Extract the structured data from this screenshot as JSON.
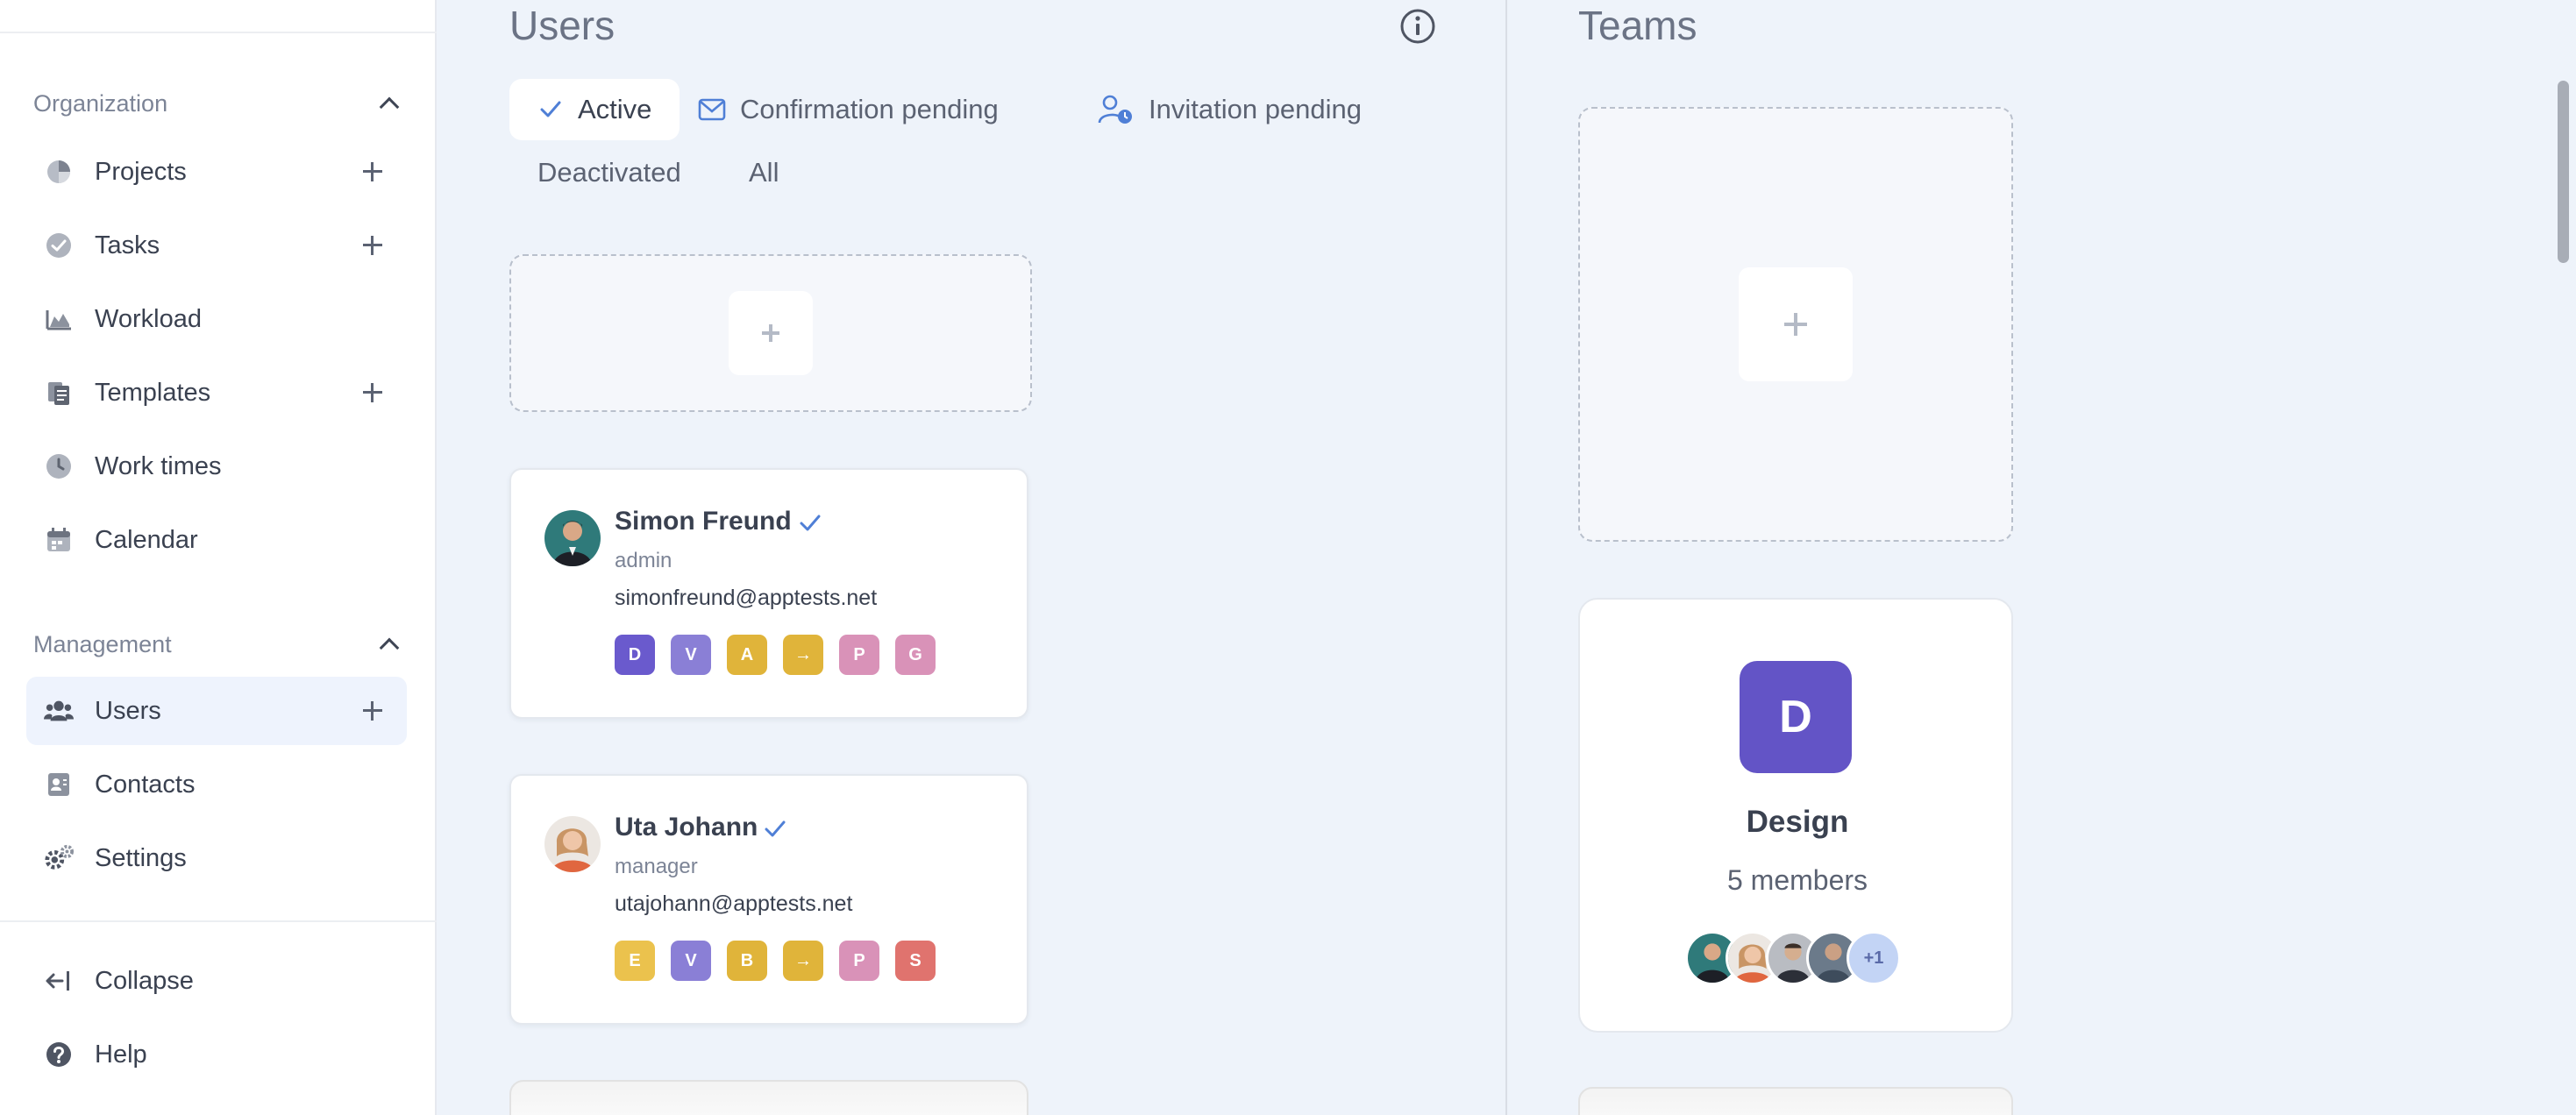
{
  "sidebar": {
    "organization_label": "Organization",
    "org_items": [
      {
        "label": "Projects",
        "icon": "pie-chart-icon",
        "has_add": true
      },
      {
        "label": "Tasks",
        "icon": "check-circle-icon",
        "has_add": true
      },
      {
        "label": "Workload",
        "icon": "area-chart-icon",
        "has_add": false
      },
      {
        "label": "Templates",
        "icon": "documents-icon",
        "has_add": true
      },
      {
        "label": "Work times",
        "icon": "clock-icon",
        "has_add": false
      },
      {
        "label": "Calendar",
        "icon": "calendar-icon",
        "has_add": false
      }
    ],
    "management_label": "Management",
    "mgmt_items": [
      {
        "label": "Users",
        "icon": "users-icon",
        "has_add": true,
        "active": true
      },
      {
        "label": "Contacts",
        "icon": "contact-card-icon",
        "has_add": false
      },
      {
        "label": "Settings",
        "icon": "gears-icon",
        "has_add": false
      }
    ],
    "bottom_items": [
      {
        "label": "Collapse",
        "icon": "collapse-arrow-icon"
      },
      {
        "label": "Help",
        "icon": "help-circle-icon"
      }
    ]
  },
  "users": {
    "title": "Users",
    "filters": [
      {
        "label": "Active",
        "icon": "check-icon",
        "active": true
      },
      {
        "label": "Confirmation pending",
        "icon": "envelope-icon"
      },
      {
        "label": "Invitation pending",
        "icon": "user-clock-icon"
      },
      {
        "label": "Deactivated"
      },
      {
        "label": "All"
      }
    ],
    "cards": [
      {
        "name": "Simon Freund",
        "role": "admin",
        "email": "simonfreund@apptests.net",
        "verified": true,
        "tags": [
          {
            "letter": "D",
            "color": "#6a5acd"
          },
          {
            "letter": "V",
            "color": "#8a7fd6"
          },
          {
            "letter": "A",
            "color": "#e0b43a"
          },
          {
            "letter": "→",
            "color": "#e0b43a"
          },
          {
            "letter": "P",
            "color": "#d992b8"
          },
          {
            "letter": "G",
            "color": "#d992b8"
          }
        ]
      },
      {
        "name": "Uta Johann",
        "role": "manager",
        "email": "utajohann@apptests.net",
        "verified": true,
        "tags": [
          {
            "letter": "E",
            "color": "#ebc24d"
          },
          {
            "letter": "V",
            "color": "#8a7fd6"
          },
          {
            "letter": "B",
            "color": "#e0b43a"
          },
          {
            "letter": "→",
            "color": "#e0b43a"
          },
          {
            "letter": "P",
            "color": "#d992b8"
          },
          {
            "letter": "S",
            "color": "#e0736e"
          }
        ]
      }
    ]
  },
  "teams": {
    "title": "Teams",
    "cards": [
      {
        "initial": "D",
        "name": "Design",
        "members": "5 members",
        "color": "#6354c6",
        "extra": "+1"
      }
    ]
  },
  "colors": {
    "accent": "#4f7fd6",
    "background": "#eef3fa",
    "text": "#3a4150"
  }
}
